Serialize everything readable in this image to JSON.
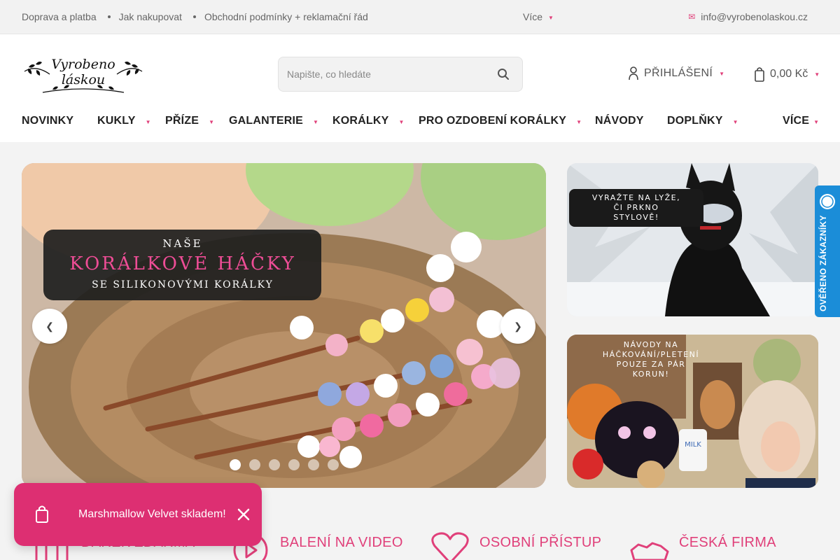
{
  "topbar": {
    "links": [
      "Doprava a platba",
      "Jak nakupovat",
      "Obchodní podmínky + reklamační řád"
    ],
    "more_label": "Více",
    "email": "info@vyrobenolaskou.cz"
  },
  "header": {
    "logo_text": "Vyrobeno láskou",
    "search_placeholder": "Napište, co hledáte",
    "login_label": "PŘIHLÁŠENÍ",
    "cart_total": "0,00 Kč"
  },
  "nav": {
    "items": [
      "NOVINKY",
      "KUKLY",
      "PŘÍZE",
      "GALANTERIE",
      "KORÁLKY",
      "PRO OZDOBENÍ KORÁLKY",
      "NÁVODY",
      "DOPLŇKY",
      "VÍCE"
    ]
  },
  "hero": {
    "title_small": "NAŠE",
    "title_big": "KORÁLKOVÉ HÁČKY",
    "subtitle": "SE SILIKONOVÝMI KORÁLKY",
    "slide_count": 6,
    "active_slide": 1
  },
  "side_banners": {
    "top_text": [
      "VYRAŽTE NA LYŽE,",
      "ČI PRKNO",
      "STYLOVĚ!"
    ],
    "bottom_text": [
      "NÁVODY NA",
      "HÁČKOVÁNÍ/PLETENÍ",
      "POUZE ZA PÁR",
      "KORUN!"
    ],
    "bottom_badge": "MILK"
  },
  "verified_badge": {
    "label": "OVĚŘENO ZÁKAZNÍKY"
  },
  "features": [
    "DÁREK ZDARMA",
    "BALENÍ NA VIDEO",
    "OSOBNÍ PŘÍSTUP",
    "ČESKÁ FIRMA"
  ],
  "toast": {
    "message": "Marshmallow Velvet skladem!"
  },
  "colors": {
    "accent": "#e0407a",
    "toast": "#dd2f72",
    "verified": "#1b8dd8"
  }
}
